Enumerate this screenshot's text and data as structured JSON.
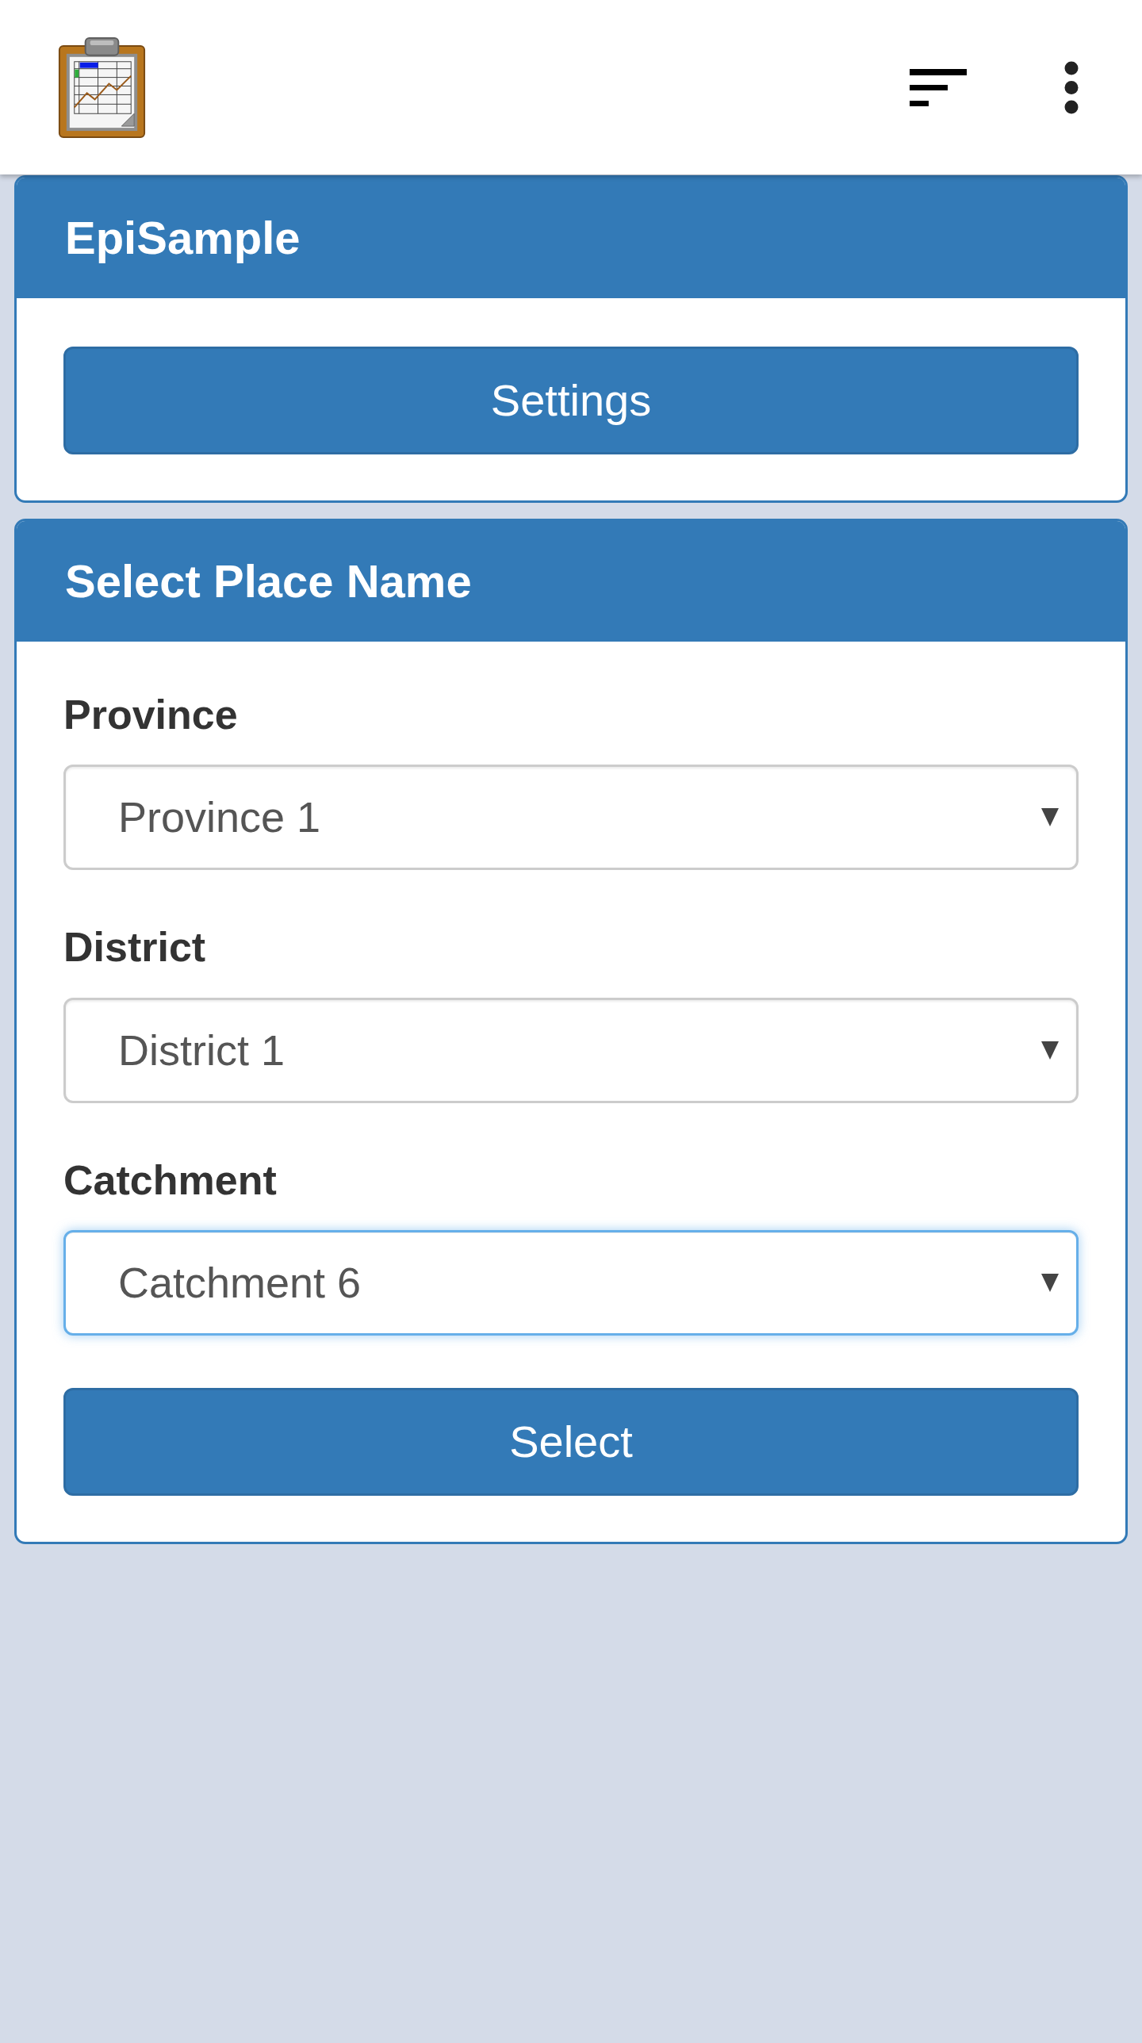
{
  "cards": [
    {
      "title": "EpiSample",
      "button": {
        "label": "Settings"
      }
    },
    {
      "title": "Select Place Name",
      "fields": [
        {
          "label": "Province",
          "value": "Province 1",
          "focused": false
        },
        {
          "label": "District",
          "value": "District 1",
          "focused": false
        },
        {
          "label": "Catchment",
          "value": "Catchment 6",
          "focused": true
        }
      ],
      "button": {
        "label": "Select"
      }
    }
  ]
}
